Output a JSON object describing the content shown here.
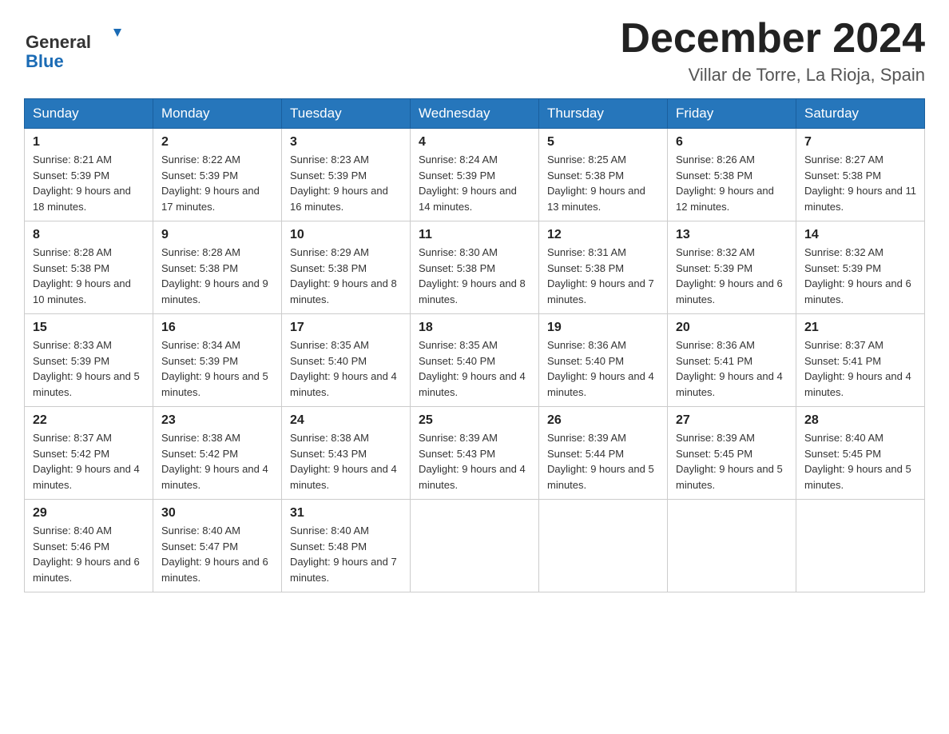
{
  "header": {
    "logo_general": "General",
    "logo_blue": "Blue",
    "month": "December 2024",
    "location": "Villar de Torre, La Rioja, Spain"
  },
  "days_of_week": [
    "Sunday",
    "Monday",
    "Tuesday",
    "Wednesday",
    "Thursday",
    "Friday",
    "Saturday"
  ],
  "weeks": [
    [
      {
        "day": "1",
        "sunrise": "8:21 AM",
        "sunset": "5:39 PM",
        "daylight": "9 hours and 18 minutes."
      },
      {
        "day": "2",
        "sunrise": "8:22 AM",
        "sunset": "5:39 PM",
        "daylight": "9 hours and 17 minutes."
      },
      {
        "day": "3",
        "sunrise": "8:23 AM",
        "sunset": "5:39 PM",
        "daylight": "9 hours and 16 minutes."
      },
      {
        "day": "4",
        "sunrise": "8:24 AM",
        "sunset": "5:39 PM",
        "daylight": "9 hours and 14 minutes."
      },
      {
        "day": "5",
        "sunrise": "8:25 AM",
        "sunset": "5:38 PM",
        "daylight": "9 hours and 13 minutes."
      },
      {
        "day": "6",
        "sunrise": "8:26 AM",
        "sunset": "5:38 PM",
        "daylight": "9 hours and 12 minutes."
      },
      {
        "day": "7",
        "sunrise": "8:27 AM",
        "sunset": "5:38 PM",
        "daylight": "9 hours and 11 minutes."
      }
    ],
    [
      {
        "day": "8",
        "sunrise": "8:28 AM",
        "sunset": "5:38 PM",
        "daylight": "9 hours and 10 minutes."
      },
      {
        "day": "9",
        "sunrise": "8:28 AM",
        "sunset": "5:38 PM",
        "daylight": "9 hours and 9 minutes."
      },
      {
        "day": "10",
        "sunrise": "8:29 AM",
        "sunset": "5:38 PM",
        "daylight": "9 hours and 8 minutes."
      },
      {
        "day": "11",
        "sunrise": "8:30 AM",
        "sunset": "5:38 PM",
        "daylight": "9 hours and 8 minutes."
      },
      {
        "day": "12",
        "sunrise": "8:31 AM",
        "sunset": "5:38 PM",
        "daylight": "9 hours and 7 minutes."
      },
      {
        "day": "13",
        "sunrise": "8:32 AM",
        "sunset": "5:39 PM",
        "daylight": "9 hours and 6 minutes."
      },
      {
        "day": "14",
        "sunrise": "8:32 AM",
        "sunset": "5:39 PM",
        "daylight": "9 hours and 6 minutes."
      }
    ],
    [
      {
        "day": "15",
        "sunrise": "8:33 AM",
        "sunset": "5:39 PM",
        "daylight": "9 hours and 5 minutes."
      },
      {
        "day": "16",
        "sunrise": "8:34 AM",
        "sunset": "5:39 PM",
        "daylight": "9 hours and 5 minutes."
      },
      {
        "day": "17",
        "sunrise": "8:35 AM",
        "sunset": "5:40 PM",
        "daylight": "9 hours and 4 minutes."
      },
      {
        "day": "18",
        "sunrise": "8:35 AM",
        "sunset": "5:40 PM",
        "daylight": "9 hours and 4 minutes."
      },
      {
        "day": "19",
        "sunrise": "8:36 AM",
        "sunset": "5:40 PM",
        "daylight": "9 hours and 4 minutes."
      },
      {
        "day": "20",
        "sunrise": "8:36 AM",
        "sunset": "5:41 PM",
        "daylight": "9 hours and 4 minutes."
      },
      {
        "day": "21",
        "sunrise": "8:37 AM",
        "sunset": "5:41 PM",
        "daylight": "9 hours and 4 minutes."
      }
    ],
    [
      {
        "day": "22",
        "sunrise": "8:37 AM",
        "sunset": "5:42 PM",
        "daylight": "9 hours and 4 minutes."
      },
      {
        "day": "23",
        "sunrise": "8:38 AM",
        "sunset": "5:42 PM",
        "daylight": "9 hours and 4 minutes."
      },
      {
        "day": "24",
        "sunrise": "8:38 AM",
        "sunset": "5:43 PM",
        "daylight": "9 hours and 4 minutes."
      },
      {
        "day": "25",
        "sunrise": "8:39 AM",
        "sunset": "5:43 PM",
        "daylight": "9 hours and 4 minutes."
      },
      {
        "day": "26",
        "sunrise": "8:39 AM",
        "sunset": "5:44 PM",
        "daylight": "9 hours and 5 minutes."
      },
      {
        "day": "27",
        "sunrise": "8:39 AM",
        "sunset": "5:45 PM",
        "daylight": "9 hours and 5 minutes."
      },
      {
        "day": "28",
        "sunrise": "8:40 AM",
        "sunset": "5:45 PM",
        "daylight": "9 hours and 5 minutes."
      }
    ],
    [
      {
        "day": "29",
        "sunrise": "8:40 AM",
        "sunset": "5:46 PM",
        "daylight": "9 hours and 6 minutes."
      },
      {
        "day": "30",
        "sunrise": "8:40 AM",
        "sunset": "5:47 PM",
        "daylight": "9 hours and 6 minutes."
      },
      {
        "day": "31",
        "sunrise": "8:40 AM",
        "sunset": "5:48 PM",
        "daylight": "9 hours and 7 minutes."
      },
      null,
      null,
      null,
      null
    ]
  ],
  "labels": {
    "sunrise": "Sunrise: ",
    "sunset": "Sunset: ",
    "daylight": "Daylight: "
  }
}
